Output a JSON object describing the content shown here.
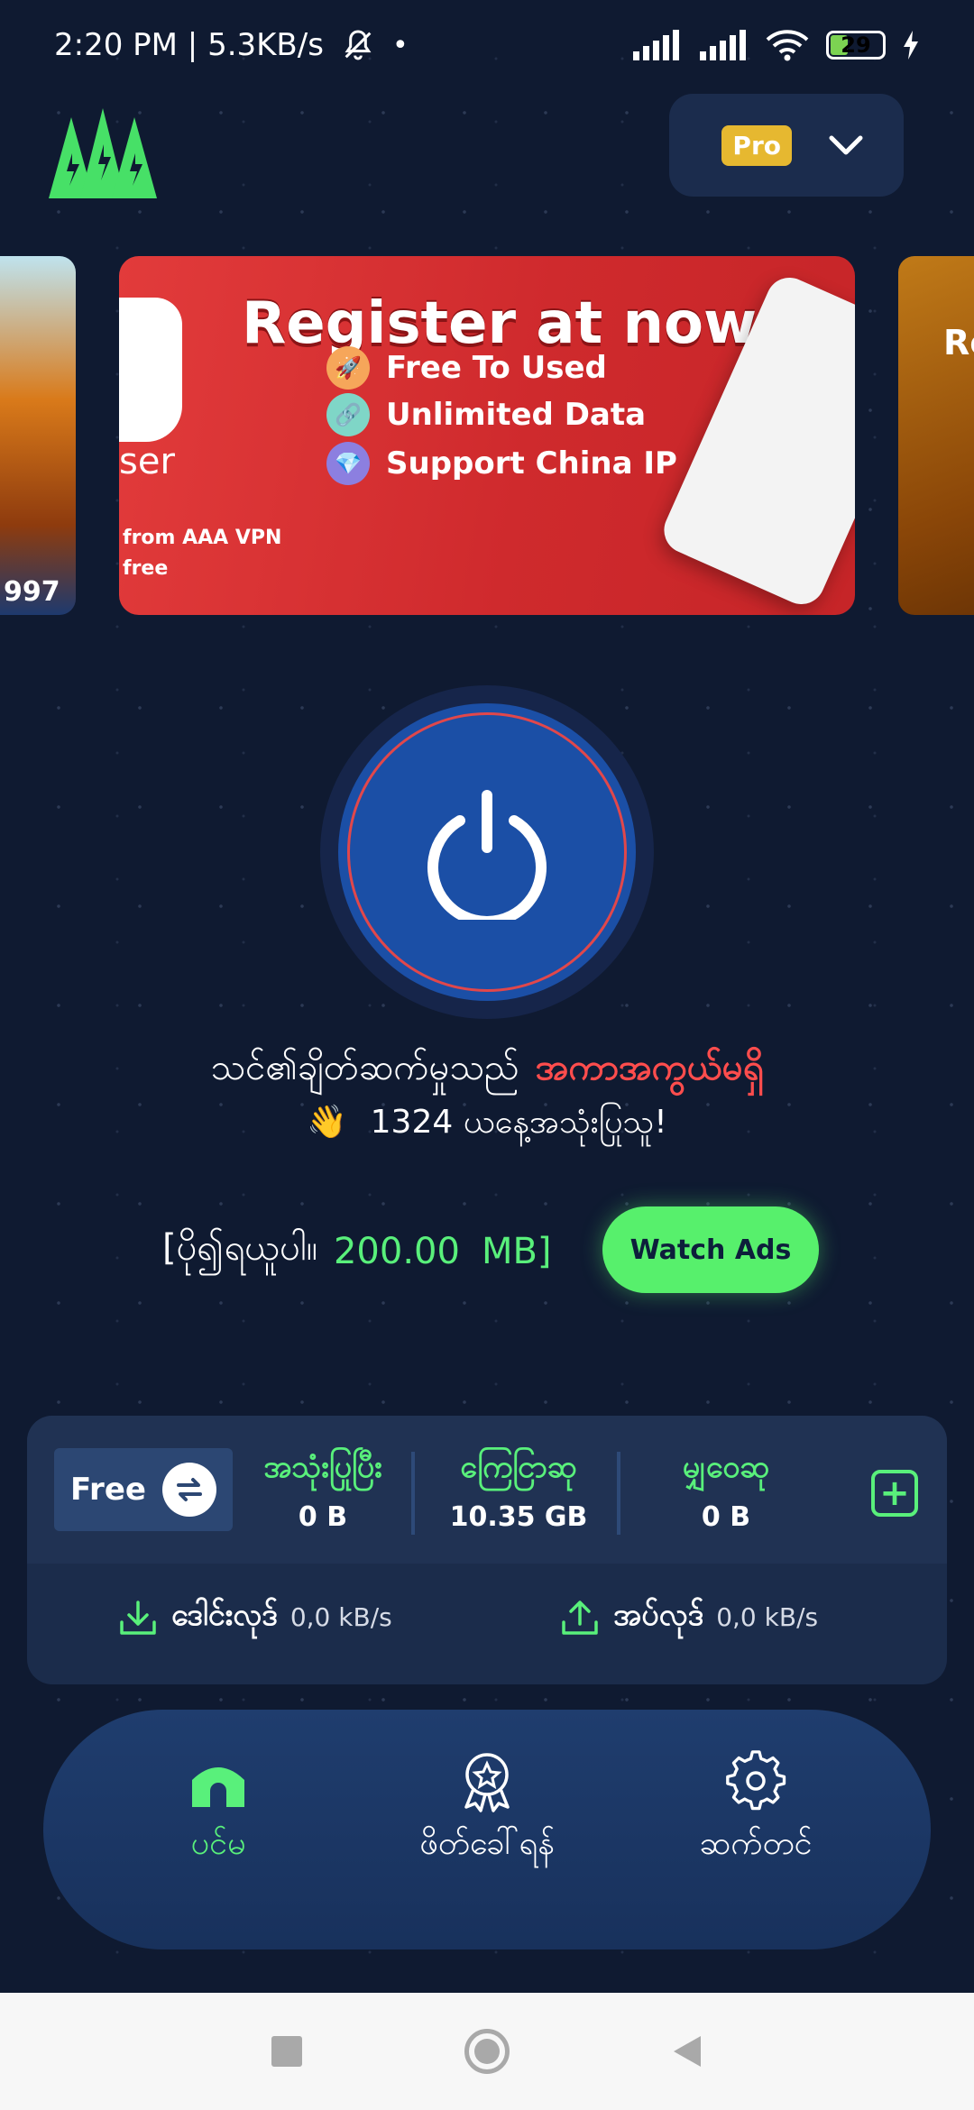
{
  "status_bar": {
    "time_speed": "2:20 PM | 5.3KB/s",
    "battery": "29"
  },
  "header": {
    "pro_label": "Pro"
  },
  "banners": {
    "left_partial_number": "997",
    "right_partial_text": "Re",
    "main": {
      "title": "Register at now",
      "side_text": "ser",
      "sub_line1": "from AAA VPN",
      "sub_line2": "free",
      "features": [
        "Free To Used",
        "Unlimited Data",
        "Support China IP"
      ]
    }
  },
  "connection": {
    "label": "သင်၏ချိတ်ဆက်မှုသည်",
    "status": "အကာအကွယ်မရှိ",
    "users_emoji": "👋",
    "users_text": "1324 ယနေ့အသုံးပြုသူ!"
  },
  "reward": {
    "prefix": "[ပို၍ရယူပါ။",
    "amount": "200.00",
    "unit": "MB]",
    "watch_button": "Watch Ads"
  },
  "stats": {
    "plan": "Free",
    "used": {
      "title": "အသုံးပြုပြီး",
      "value": "0 B"
    },
    "remaining": {
      "title": "ကြေငြာဆု",
      "value": "10.35  GB"
    },
    "invite": {
      "title": "မျှဝေဆု",
      "value": "0 B"
    },
    "download": {
      "label": "ဒေါင်းလုဒ်",
      "value": "0,0 kB/s"
    },
    "upload": {
      "label": "အပ်လုဒ်",
      "value": "0,0 kB/s"
    }
  },
  "nav": {
    "home": "ပင်မ",
    "rewards": "ဖိတ်ခေါ်ရန်",
    "settings": "ဆက်တင်"
  },
  "colors": {
    "accent_green": "#59f07b",
    "danger_red": "#ff4d4d",
    "background": "#0f1a31"
  }
}
